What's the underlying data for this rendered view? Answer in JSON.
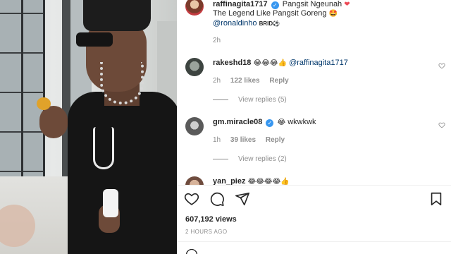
{
  "caption": {
    "username": "raffinagita1717",
    "line1": "Pangsit Ngeunah",
    "line1_emoji": "❤",
    "line2": "The Legend Like Pangsit Goreng",
    "line2_emoji": "🤩",
    "mention": "@ronaldinho",
    "mention_suffix": "BRID⚽",
    "time": "2h"
  },
  "comments": [
    {
      "username": "rakeshd18",
      "emojis": "😂😂😂👍",
      "mention": "@raffinagita1717",
      "text": "",
      "time": "2h",
      "likes": "122 likes",
      "reply": "Reply",
      "view_replies": "View replies (5)"
    },
    {
      "username": "gm.miracle08",
      "emojis": "😂",
      "mention": "",
      "text": "wkwkwk",
      "time": "1h",
      "likes": "39 likes",
      "reply": "Reply",
      "view_replies": "View replies (2)"
    },
    {
      "username": "yan_piez",
      "emojis": "😂😂😂😂👍"
    }
  ],
  "views": "607,192 views",
  "posted": "2 HOURS AGO",
  "icons": {
    "like": "heart-icon",
    "comment": "comment-icon",
    "share": "share-icon",
    "save": "bookmark-icon",
    "emoji": "emoji-icon"
  },
  "colors": {
    "text": "#262626",
    "muted": "#8e8e8e",
    "mention": "#00376b",
    "verified": "#3897f0",
    "heart": "#ed4956"
  }
}
